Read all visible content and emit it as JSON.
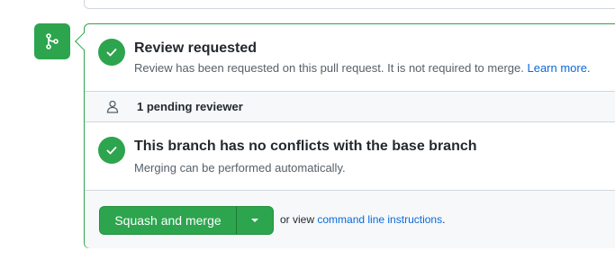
{
  "review": {
    "title": "Review requested",
    "description": "Review has been requested on this pull request. It is not required to merge.",
    "learn_more": "Learn more."
  },
  "pending": {
    "label": "1 pending reviewer"
  },
  "conflicts": {
    "title": "This branch has no conflicts with the base branch",
    "description": "Merging can be performed automatically."
  },
  "actions": {
    "merge_button": "Squash and merge",
    "or_view": "or view",
    "cli_link": "command line instructions",
    "period": "."
  },
  "icons": {
    "merge_tile": "git-merge-icon",
    "check": "check-icon",
    "person": "person-icon",
    "caret": "caret-down-icon"
  },
  "colors": {
    "success": "#2da44e",
    "link": "#0969da",
    "muted": "#57606a"
  }
}
